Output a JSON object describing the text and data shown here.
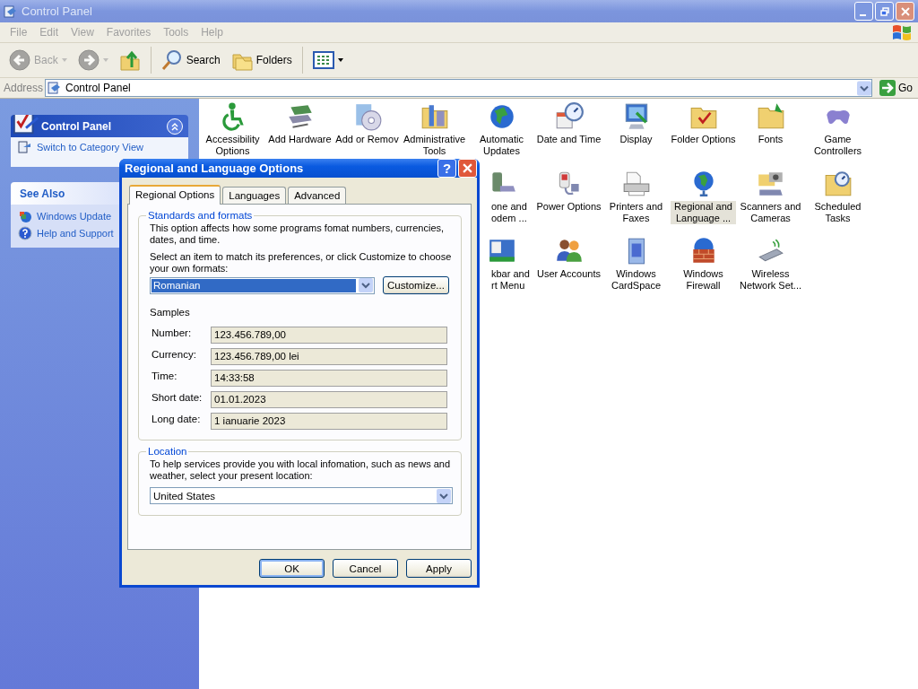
{
  "window": {
    "title": "Control Panel"
  },
  "menu": [
    "File",
    "Edit",
    "View",
    "Favorites",
    "Tools",
    "Help"
  ],
  "toolbar": [
    {
      "kind": "back",
      "label": "Back",
      "disabled": true
    },
    {
      "kind": "forward",
      "disabled": true
    },
    {
      "kind": "up",
      "disabled": false
    },
    {
      "kind": "search",
      "label": "Search",
      "disabled": false
    },
    {
      "kind": "folders",
      "label": "Folders",
      "disabled": false
    },
    {
      "kind": "views",
      "disabled": false
    }
  ],
  "address": {
    "label": "Address",
    "value": "Control Panel",
    "go": "Go"
  },
  "sidebar": {
    "panels": [
      {
        "kind": "primary",
        "title": "Control Panel",
        "links": [
          "Switch to Category View"
        ]
      },
      {
        "kind": "plain",
        "title": "See Also",
        "links": [
          "Windows Update",
          "Help and Support"
        ]
      }
    ]
  },
  "icons": {
    "rows": [
      [
        {
          "label": "Accessibility Options",
          "kind": "full",
          "selected": false
        },
        {
          "label": "Add Hardware",
          "kind": "full",
          "selected": false
        },
        {
          "label": "Add or Remov",
          "kind": "full",
          "selected": false
        },
        {
          "label": "Administrative Tools",
          "kind": "full",
          "selected": false
        },
        {
          "label": "Automatic Updates",
          "kind": "full",
          "selected": false
        },
        {
          "label": "Date and Time",
          "kind": "full",
          "selected": false
        },
        {
          "label": "Display",
          "kind": "full",
          "selected": false
        },
        {
          "label": "Folder Options",
          "kind": "full",
          "selected": false
        },
        {
          "label": "Fonts",
          "kind": "full",
          "selected": false
        },
        {
          "label": "Game Controllers",
          "kind": "full",
          "selected": false
        }
      ],
      [
        "",
        "",
        "",
        "",
        {
          "label": "one and odem ...",
          "kind": "partial",
          "selected": false
        },
        {
          "label": "Power Options",
          "kind": "full",
          "selected": false
        },
        {
          "label": "Printers and Faxes",
          "kind": "full",
          "selected": false
        },
        {
          "label": "Regional and Language ...",
          "kind": "full",
          "selected": true
        },
        {
          "label": "Scanners and Cameras",
          "kind": "full",
          "selected": false
        },
        {
          "label": "Scheduled Tasks",
          "kind": "full",
          "selected": false
        }
      ],
      [
        "",
        "",
        "",
        "",
        {
          "label": "kbar and rt Menu",
          "kind": "partial",
          "selected": false
        },
        {
          "label": "User Accounts",
          "kind": "full",
          "selected": false
        },
        {
          "label": "Windows CardSpace",
          "kind": "full",
          "selected": false
        },
        {
          "label": "Windows Firewall",
          "kind": "full",
          "selected": false
        },
        {
          "label": "Wireless Network Set...",
          "kind": "full",
          "selected": false
        }
      ]
    ]
  },
  "dialog": {
    "title": "Regional and Language Options",
    "help": "?",
    "tabs": [
      {
        "label": "Regional Options",
        "selected": true
      },
      {
        "label": "Languages",
        "selected": false
      },
      {
        "label": "Advanced",
        "selected": false
      }
    ],
    "standards": {
      "legend": "Standards and formats",
      "description": "This option affects how some programs fomat numbers, currencies, dates, and time.",
      "prompt": "Select an item to match its preferences, or click Customize to choose your own formats:",
      "format": "Romanian",
      "customize": "Customize...",
      "samples_label": "Samples",
      "samples": [
        {
          "label": "Number:",
          "value": "123.456.789,00"
        },
        {
          "label": "Currency:",
          "value": "123.456.789,00 lei"
        },
        {
          "label": "Time:",
          "value": "14:33:58"
        },
        {
          "label": "Short date:",
          "value": "01.01.2023"
        },
        {
          "label": "Long date:",
          "value": "1 ianuarie 2023"
        }
      ]
    },
    "location": {
      "legend": "Location",
      "description": "To help services provide you with local infomation, such as news and weather, select your present location:",
      "value": "United States"
    },
    "buttons": [
      {
        "label": "OK",
        "default": true
      },
      {
        "label": "Cancel",
        "default": false
      },
      {
        "label": "Apply",
        "default": false
      }
    ]
  }
}
